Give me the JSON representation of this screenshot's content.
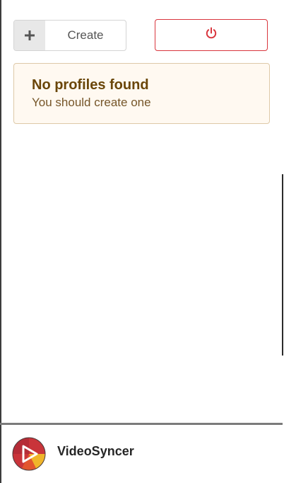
{
  "toolbar": {
    "create_label": "Create",
    "plus_icon": "plus-icon",
    "power_icon": "power-icon",
    "power_color": "#d9363e"
  },
  "message": {
    "title": "No profiles found",
    "text": "You should create one",
    "background": "#fff9f1",
    "border": "#dec9a8",
    "title_color": "#6a4609"
  },
  "footer": {
    "app_name": "VideoSyncer",
    "logo_icon": "videosyncer-logo-icon"
  }
}
